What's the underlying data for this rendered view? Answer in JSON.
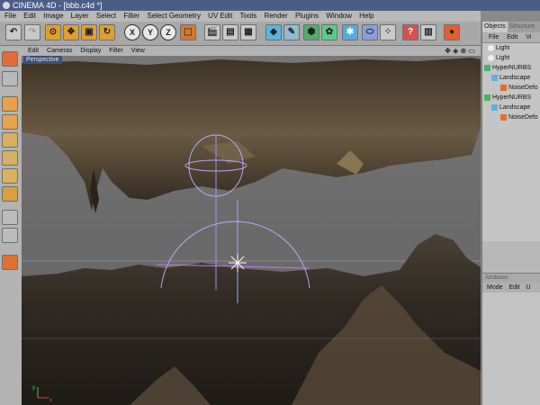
{
  "window": {
    "title": "CINEMA 4D - [bbb.c4d *]"
  },
  "menubar": [
    "File",
    "Edit",
    "Image",
    "Layer",
    "Select",
    "Filter",
    "Select Geometry",
    "UV Edit",
    "Tools",
    "Render",
    "Plugins",
    "Window",
    "Help"
  ],
  "toolbar": {
    "x_axis_label": "X",
    "y_axis_label": "Y",
    "z_axis_label": "Z"
  },
  "viewport": {
    "menu": [
      "Edit",
      "Cameras",
      "Display",
      "Filter",
      "View"
    ],
    "label": "Perspective",
    "axis_x": "x",
    "axis_y": "y"
  },
  "panel": {
    "tabs": [
      "Objects",
      "Structure"
    ],
    "menu": [
      "File",
      "Edit",
      "Vi"
    ],
    "objects": [
      {
        "name": "Light",
        "indent": 0,
        "icon": "light-icon"
      },
      {
        "name": "Light",
        "indent": 0,
        "icon": "light-icon"
      },
      {
        "name": "HyperNURBS",
        "indent": 0,
        "icon": "hypernurbs-icon"
      },
      {
        "name": "Landscape",
        "indent": 1,
        "icon": "landscape-icon"
      },
      {
        "name": "NoiseDefo",
        "indent": 2,
        "icon": "deformer-icon"
      },
      {
        "name": "HyperNURBS",
        "indent": 0,
        "icon": "hypernurbs-icon"
      },
      {
        "name": "Landscape",
        "indent": 1,
        "icon": "landscape-icon"
      },
      {
        "name": "NoiseDefo",
        "indent": 2,
        "icon": "deformer-icon"
      }
    ],
    "attributes": {
      "header": "Attributes",
      "menu": [
        "Mode",
        "Edit",
        "U"
      ]
    }
  }
}
